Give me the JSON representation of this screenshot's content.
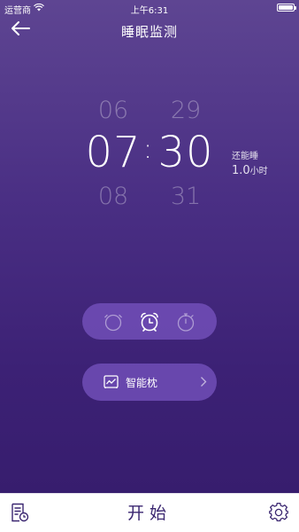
{
  "status_bar": {
    "carrier": "运营商",
    "time": "上午6:31"
  },
  "nav": {
    "title": "睡眠监测"
  },
  "time_picker": {
    "hour_above": "06",
    "hour": "07",
    "hour_below": "08",
    "separator": ":",
    "minute_above": "29",
    "minute": "30",
    "minute_below": "31"
  },
  "remaining": {
    "label": "还能睡",
    "value": "1.0",
    "unit": "小时"
  },
  "modes": {
    "selected": "alarm-clock",
    "items": [
      "clock-face-icon",
      "alarm-clock-icon",
      "timer-icon"
    ]
  },
  "device": {
    "label": "智能枕",
    "icon": "pillow-chart-icon"
  },
  "bottom_bar": {
    "start_label": "开始"
  },
  "colors": {
    "gradient_top": "#5e4592",
    "gradient_bottom": "#371d6e",
    "pill": "#7a56c4",
    "start_text": "#3a2670"
  }
}
